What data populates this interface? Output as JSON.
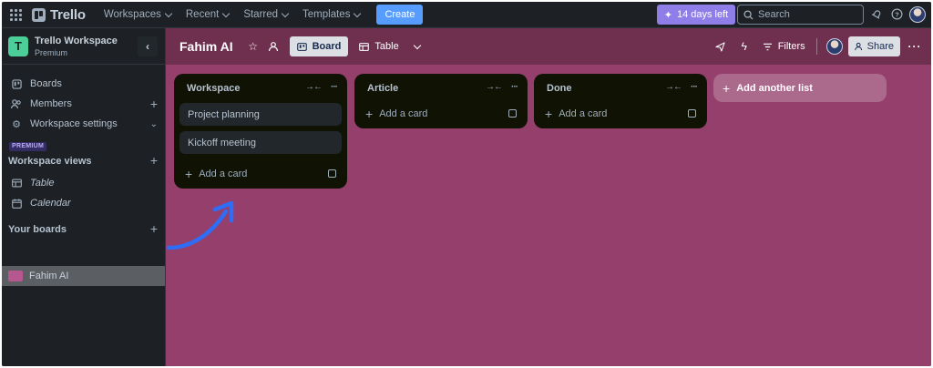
{
  "topbar": {
    "logo_text": "Trello",
    "nav": [
      "Workspaces",
      "Recent",
      "Starred",
      "Templates"
    ],
    "create_label": "Create",
    "trial_label": "14 days left",
    "search_placeholder": "Search",
    "icons": [
      "apps-grid-icon",
      "trello-logo-icon",
      "sparkle-icon",
      "search-icon",
      "bell-icon",
      "help-icon",
      "avatar"
    ]
  },
  "sidebar": {
    "workspace_initial": "T",
    "workspace_name": "Trello Workspace",
    "workspace_plan": "Premium",
    "collapse_icon": "chevron-left-icon",
    "items": [
      {
        "label": "Boards",
        "icon": "board-icon"
      },
      {
        "label": "Members",
        "icon": "members-icon"
      },
      {
        "label": "Workspace settings",
        "icon": "gear-icon"
      }
    ],
    "premium_badge": "PREMIUM",
    "views_title": "Workspace views",
    "views": [
      {
        "label": "Table",
        "icon": "table-icon"
      },
      {
        "label": "Calendar",
        "icon": "calendar-icon"
      }
    ],
    "boards_title": "Your boards",
    "boards": [
      {
        "label": "Fahim AI",
        "color": "#b6588f"
      }
    ]
  },
  "board": {
    "title": "Fahim AI",
    "views": {
      "board": "Board",
      "table": "Table"
    },
    "filters_label": "Filters",
    "share_label": "Share",
    "background_color": "#943f6c",
    "header_color": "#6f2f4f",
    "lists": [
      {
        "title": "Workspace",
        "cards": [
          "Project planning",
          "Kickoff meeting"
        ],
        "add_label": "Add a card"
      },
      {
        "title": "Article",
        "cards": [],
        "add_label": "Add a card"
      },
      {
        "title": "Done",
        "cards": [],
        "add_label": "Add a card"
      }
    ],
    "add_list_label": "Add another list"
  },
  "annotation": {
    "icon": "arrow-annotation-icon",
    "color": "#2f6df6"
  }
}
